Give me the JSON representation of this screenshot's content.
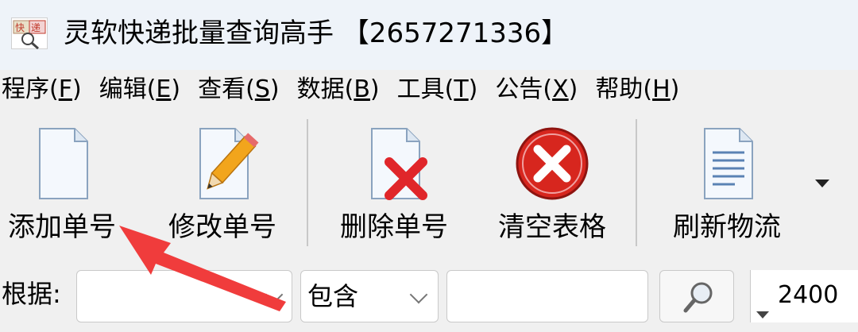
{
  "window": {
    "title": "灵软快递批量查询高手 【2657271336】",
    "icon": "app-logo-icon"
  },
  "menubar": {
    "items": [
      {
        "label": "程序(",
        "key": "F",
        "close": ")"
      },
      {
        "label": "编辑(",
        "key": "E",
        "close": ")"
      },
      {
        "label": "查看(",
        "key": "S",
        "close": ")"
      },
      {
        "label": "数据(",
        "key": "B",
        "close": ")"
      },
      {
        "label": "工具(",
        "key": "T",
        "close": ")"
      },
      {
        "label": "公告(",
        "key": "X",
        "close": ")"
      },
      {
        "label": "帮助(",
        "key": "H",
        "close": ")"
      }
    ]
  },
  "toolbar": {
    "add_label": "添加单号",
    "edit_label": "修改单号",
    "delete_label": "删除单号",
    "clear_label": "清空表格",
    "refresh_label": "刷新物流"
  },
  "filter": {
    "label": "根据:",
    "field_value": "",
    "match_value": "包含",
    "search_value": "",
    "count_value": "2400"
  },
  "colors": {
    "annotation_arrow": "#f03c3c",
    "clear_icon": "#d7261e",
    "delete_x": "#e0262a",
    "pencil": "#f2a51c"
  }
}
